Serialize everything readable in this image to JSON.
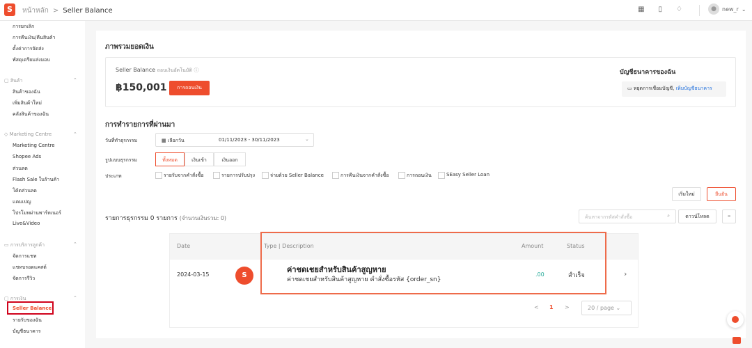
{
  "header": {
    "home": "หน้าหลัก",
    "separator": ">",
    "page": "Seller Balance",
    "user": "new_r",
    "icons": [
      "apps-grid-icon",
      "book-icon",
      "bell-icon"
    ]
  },
  "sidebar": {
    "order_items": [
      "การยกเลิก",
      "การคืนเงิน/คืนสินค้า",
      "ตั้งค่าการจัดส่ง",
      "พัสดุเตรียมส่งมอบ"
    ],
    "products_head": "สินค้า",
    "products_items": [
      "สินค้าของฉัน",
      "เพิ่มสินค้าใหม่",
      "คลังสินค้าของฉัน"
    ],
    "marketing_head": "Marketing Centre",
    "marketing_items": [
      "Marketing Centre",
      "Shopee Ads",
      "ส่วนลด",
      "Flash Sale ในร้านค้า",
      "โค้ดส่วนลด",
      "แคมเปญ",
      "โปรโมทผ่านพาร์ทเนอร์",
      "Live&Video"
    ],
    "service_head": "การบริการลูกค้า",
    "service_items": [
      "จัดการแชท",
      "แชทบรอดแคสต์",
      "จัดการรีวิว"
    ],
    "finance_head": "การเงิน",
    "finance_active": "Seller Balance",
    "finance_items": [
      "รายรับของฉัน",
      "บัญชีธนาคาร"
    ]
  },
  "overview": {
    "title": "ภาพรวมยอดเงิน",
    "balance_label": "Seller Balance",
    "balance_sub": "ถอนเงินอัตโนมัติ",
    "amount": "฿150,001",
    "withdraw": "การถอนเงิน",
    "bank_title": "บัญชีธนาคารของฉัน",
    "bank_text": "หยุดการเชื่อมบัญชี,",
    "bank_link": "เพิ่มบัญชีธนาคาร"
  },
  "recent": {
    "title": "การทำรายการที่ผ่านมา",
    "date_label": "วันที่ทำธุรกรรม",
    "date_pick": "เลือกวัน",
    "date_range": "01/11/2023 - 30/11/2023",
    "type_label": "รูปแบบธุรกรรม",
    "types": [
      "ทั้งหมด",
      "เงินเข้า",
      "เงินออก"
    ],
    "category_label": "ประเภท",
    "categories": [
      "รายรับจากคำสั่งซื้อ",
      "รายการปรับปรุง",
      "จ่ายด้วย Seller Balance",
      "การคืนเงินจากคำสั่งซื้อ",
      "การถอนเงิน",
      "SEasy Seller Loan"
    ],
    "reset": "เริ่มใหม่",
    "apply": "ยืนยัน"
  },
  "list": {
    "summary": "รายการธุรกรรม 0 รายการ",
    "summary_sub": "(จำนวนเงินรวม: 0)",
    "search_placeholder": "ค้นหาจากรหัสคำสั่งซื้อ",
    "download": "ดาวน์โหลด",
    "columns": [
      "Date",
      "Type | Description",
      "Amount",
      "Status"
    ],
    "row": {
      "date": "2024-03-15",
      "title": "ค่าชดเชยสำหรับสินค้าสูญหาย",
      "desc": "ค่าชดเชยสำหรับสินค้าสูญหาย คำสั่งซื้อรหัส {order_sn}",
      "amount": ".00",
      "status": "สำเร็จ"
    },
    "pager": {
      "prev": "<",
      "page": "1",
      "next": ">",
      "size": "20 / page"
    }
  }
}
